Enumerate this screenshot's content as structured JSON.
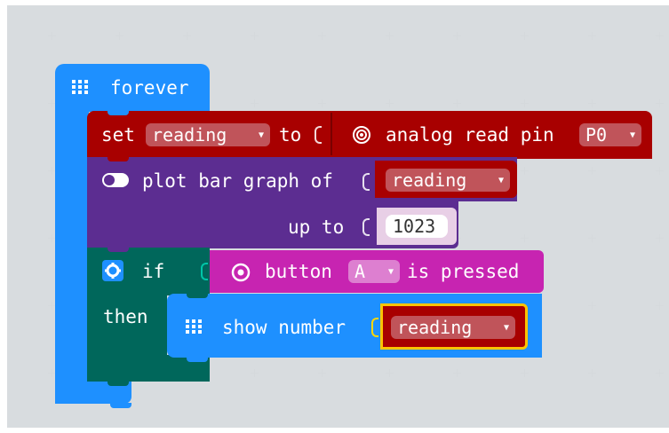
{
  "colors": {
    "workspace": "#ecf0f1",
    "loops_blue": "#1e90ff",
    "variables_red": "#a80000",
    "led_purple": "#5c2d91",
    "logic_teal": "#00675b",
    "input_magenta": "#c724b1",
    "basic_blue": "#1e90ff",
    "math_light": "#e8cfe6"
  },
  "forever_block": {
    "label": "forever",
    "icon": "grid-icon"
  },
  "set_block": {
    "label_set": "set",
    "variable": "reading",
    "label_to": "to",
    "analog": {
      "icon": "pin-icon",
      "label": "analog read pin",
      "pin": "P0"
    }
  },
  "plot_block": {
    "icon": "toggle-icon",
    "label": "plot bar graph of",
    "value_var": "reading",
    "label_up_to": "up to",
    "up_to_value": "1023"
  },
  "if_block": {
    "icon": "gear-icon",
    "label_if": "if",
    "label_then": "then",
    "condition": {
      "icon": "button-icon",
      "label_button": "button",
      "button": "A",
      "label_pressed": "is pressed"
    }
  },
  "show_block": {
    "icon": "grid-icon",
    "label": "show number",
    "value_var": "reading"
  }
}
